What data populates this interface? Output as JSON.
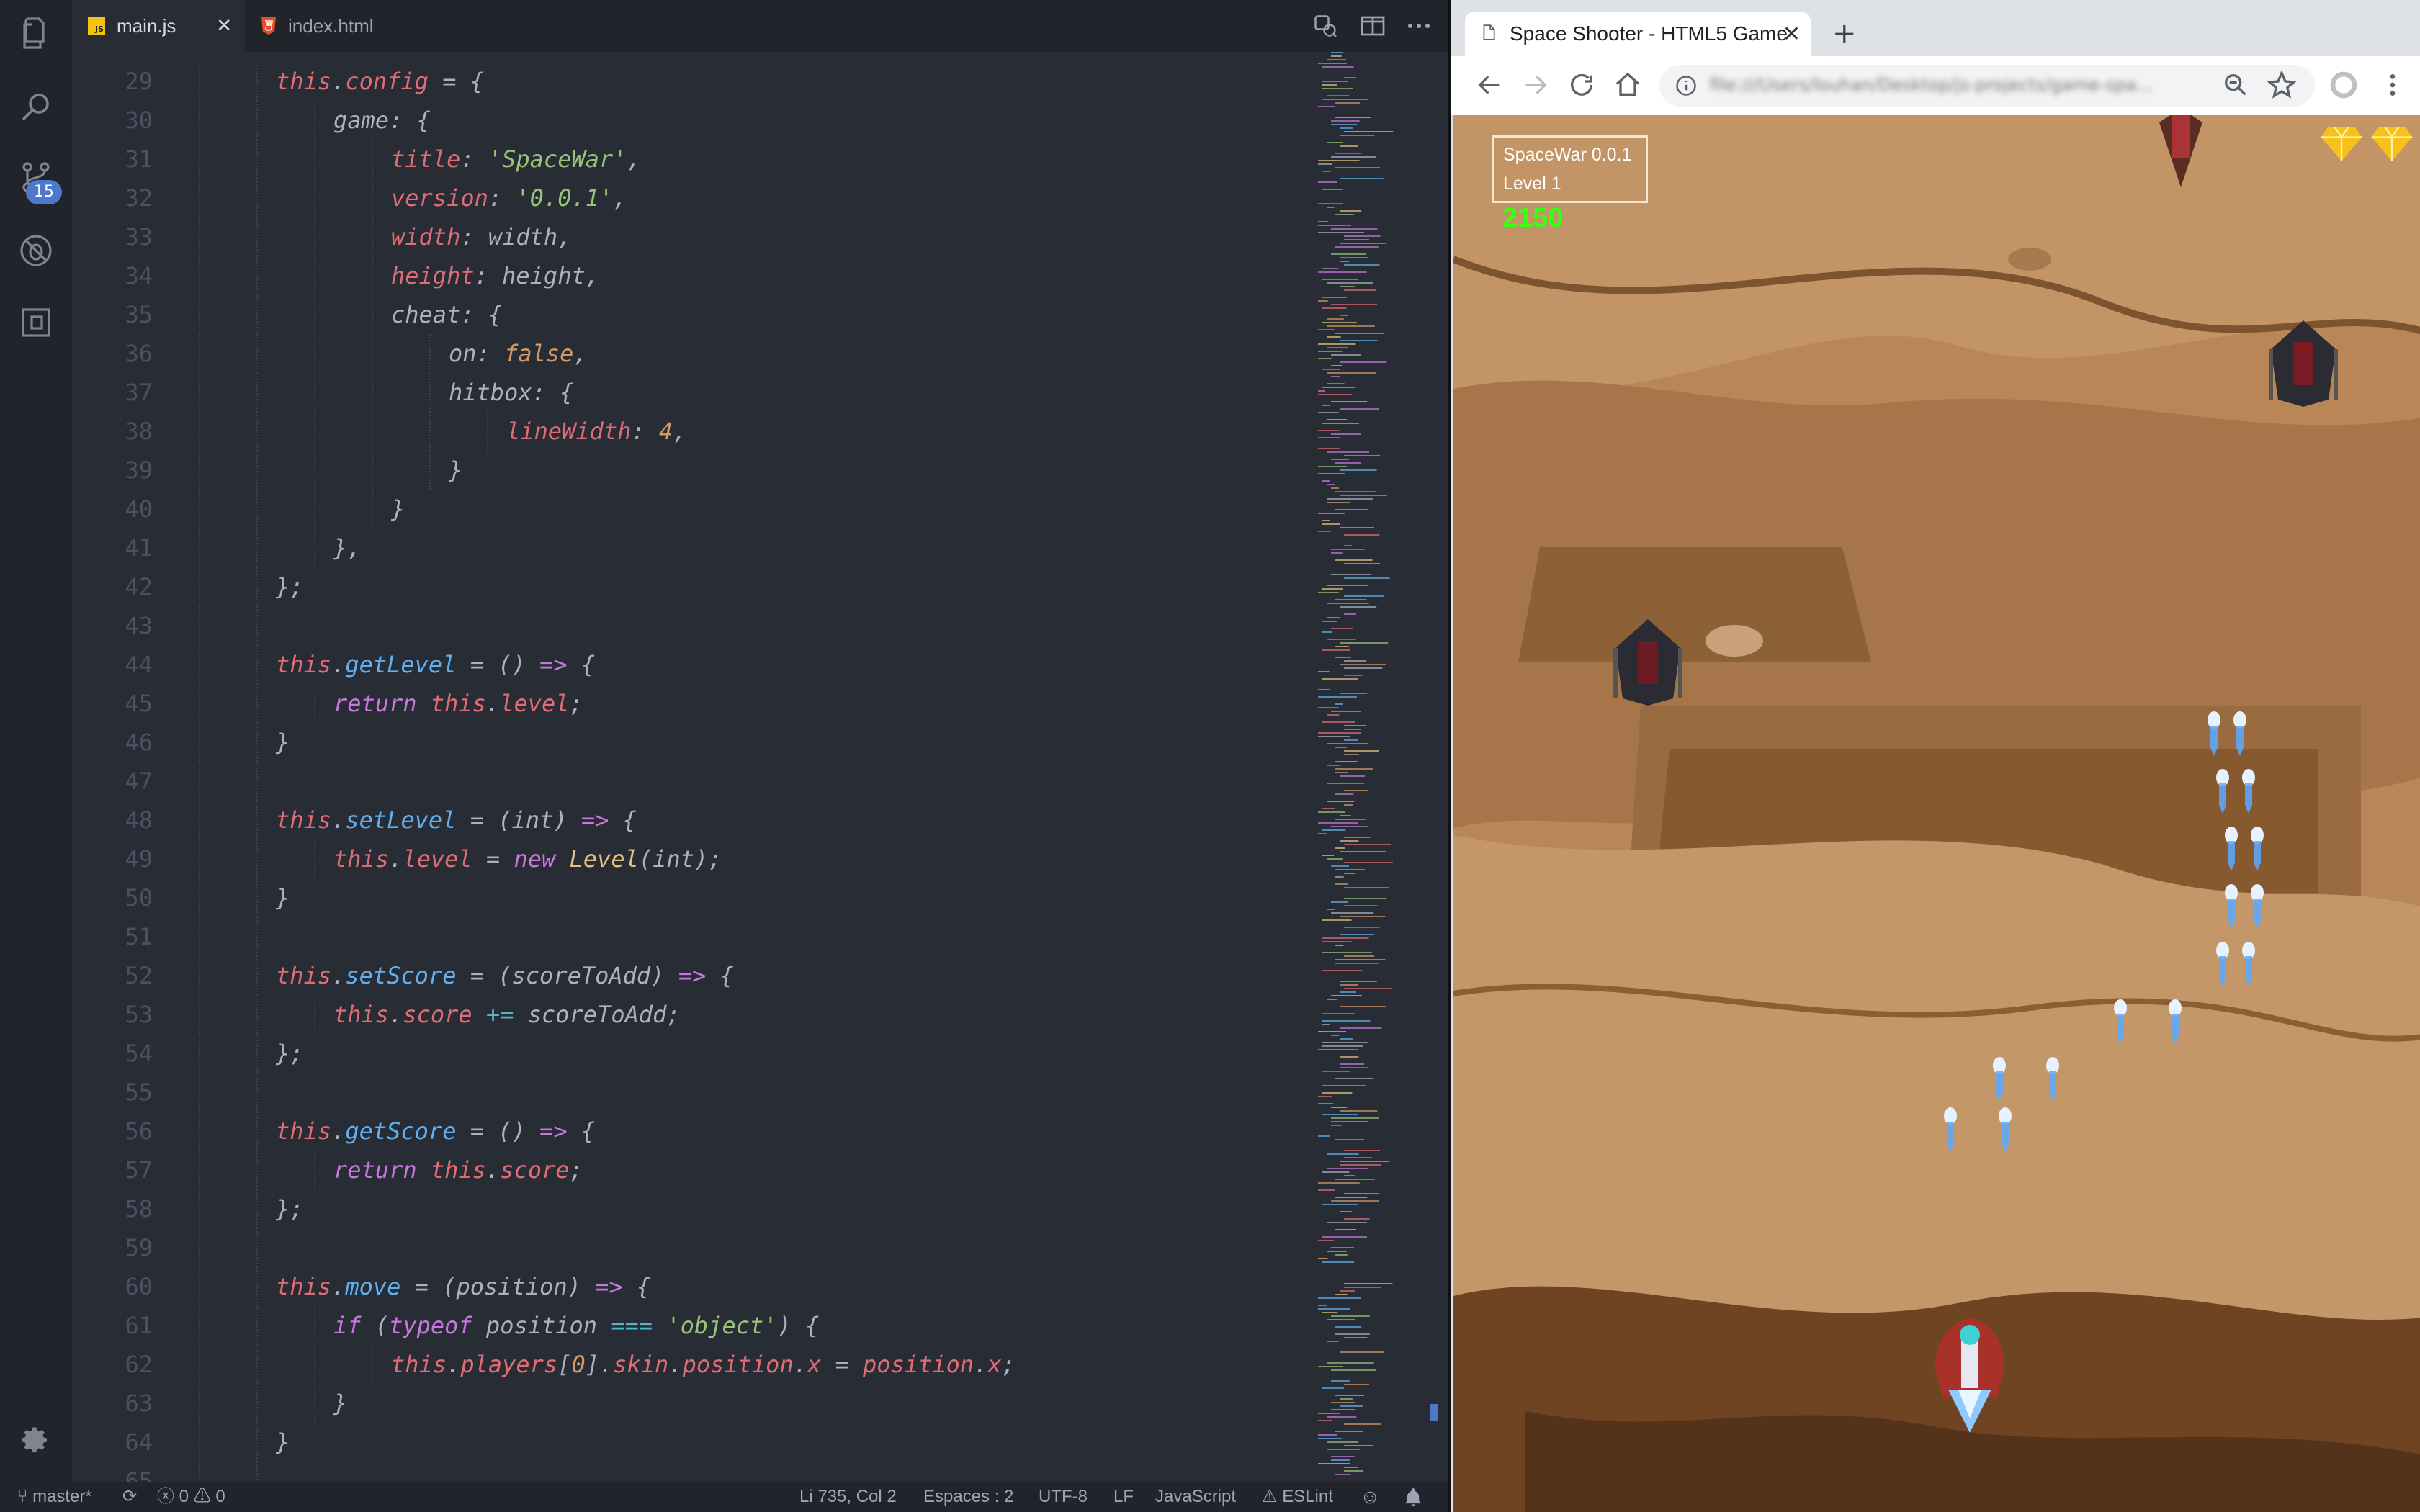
{
  "editor": {
    "tabs": [
      {
        "label": "main.js",
        "icon": "js-file-icon"
      },
      {
        "label": "index.html",
        "icon": "html5-file-icon"
      }
    ],
    "scm_badge": "15",
    "js_badge": "JS",
    "lines": [
      {
        "n": "29",
        "indent": 2,
        "tokens": [
          [
            "this",
            "tok-this"
          ],
          [
            ".",
            ""
          ],
          [
            "config",
            "tok-prop"
          ],
          [
            " = {",
            ""
          ]
        ]
      },
      {
        "n": "30",
        "indent": 3,
        "tokens": [
          [
            "game",
            "tok-key"
          ],
          [
            ": {",
            ""
          ]
        ]
      },
      {
        "n": "31",
        "indent": 4,
        "tokens": [
          [
            "title",
            "tok-prop"
          ],
          [
            ": ",
            ""
          ],
          [
            "'SpaceWar'",
            "tok-str"
          ],
          [
            ",",
            ""
          ]
        ]
      },
      {
        "n": "32",
        "indent": 4,
        "tokens": [
          [
            "version",
            "tok-prop"
          ],
          [
            ": ",
            ""
          ],
          [
            "'0.0.1'",
            "tok-str"
          ],
          [
            ",",
            ""
          ]
        ]
      },
      {
        "n": "33",
        "indent": 4,
        "tokens": [
          [
            "width",
            "tok-prop"
          ],
          [
            ": width,",
            ""
          ]
        ]
      },
      {
        "n": "34",
        "indent": 4,
        "tokens": [
          [
            "height",
            "tok-prop"
          ],
          [
            ": height,",
            ""
          ]
        ]
      },
      {
        "n": "35",
        "indent": 4,
        "tokens": [
          [
            "cheat",
            "tok-key"
          ],
          [
            ": {",
            ""
          ]
        ]
      },
      {
        "n": "36",
        "indent": 5,
        "tokens": [
          [
            "on",
            "tok-key"
          ],
          [
            ": ",
            ""
          ],
          [
            "false",
            "tok-num"
          ],
          [
            ",",
            ""
          ]
        ]
      },
      {
        "n": "37",
        "indent": 5,
        "tokens": [
          [
            "hitbox",
            "tok-key"
          ],
          [
            ": {",
            ""
          ]
        ]
      },
      {
        "n": "38",
        "indent": 6,
        "tokens": [
          [
            "lineWidth",
            "tok-prop"
          ],
          [
            ": ",
            ""
          ],
          [
            "4",
            "tok-num"
          ],
          [
            ",",
            ""
          ]
        ]
      },
      {
        "n": "39",
        "indent": 5,
        "tokens": [
          [
            "}",
            ""
          ]
        ]
      },
      {
        "n": "40",
        "indent": 4,
        "tokens": [
          [
            "}",
            ""
          ]
        ]
      },
      {
        "n": "41",
        "indent": 3,
        "tokens": [
          [
            "},",
            ""
          ]
        ]
      },
      {
        "n": "42",
        "indent": 2,
        "tokens": [
          [
            "};",
            ""
          ]
        ]
      },
      {
        "n": "43",
        "indent": 2,
        "tokens": []
      },
      {
        "n": "44",
        "indent": 2,
        "tokens": [
          [
            "this",
            "tok-this"
          ],
          [
            ".",
            ""
          ],
          [
            "getLevel",
            "tok-fn"
          ],
          [
            " = () ",
            ""
          ],
          [
            "=>",
            "tok-kw"
          ],
          [
            " {",
            ""
          ]
        ]
      },
      {
        "n": "45",
        "indent": 3,
        "tokens": [
          [
            "return",
            "tok-kw"
          ],
          [
            " ",
            ""
          ],
          [
            "this",
            "tok-this"
          ],
          [
            ".",
            ""
          ],
          [
            "level",
            "tok-prop"
          ],
          [
            ";",
            ""
          ]
        ]
      },
      {
        "n": "46",
        "indent": 2,
        "tokens": [
          [
            "}",
            ""
          ]
        ]
      },
      {
        "n": "47",
        "indent": 2,
        "tokens": []
      },
      {
        "n": "48",
        "indent": 2,
        "tokens": [
          [
            "this",
            "tok-this"
          ],
          [
            ".",
            ""
          ],
          [
            "setLevel",
            "tok-fn"
          ],
          [
            " = (int) ",
            ""
          ],
          [
            "=>",
            "tok-kw"
          ],
          [
            " {",
            ""
          ]
        ]
      },
      {
        "n": "49",
        "indent": 3,
        "tokens": [
          [
            "this",
            "tok-this"
          ],
          [
            ".",
            ""
          ],
          [
            "level",
            "tok-prop"
          ],
          [
            " = ",
            ""
          ],
          [
            "new",
            "tok-kw"
          ],
          [
            " ",
            ""
          ],
          [
            "Level",
            "tok-cls"
          ],
          [
            "(int);",
            ""
          ]
        ]
      },
      {
        "n": "50",
        "indent": 2,
        "tokens": [
          [
            "}",
            ""
          ]
        ]
      },
      {
        "n": "51",
        "indent": 2,
        "tokens": []
      },
      {
        "n": "52",
        "indent": 2,
        "tokens": [
          [
            "this",
            "tok-this"
          ],
          [
            ".",
            ""
          ],
          [
            "setScore",
            "tok-fn"
          ],
          [
            " = (scoreToAdd) ",
            ""
          ],
          [
            "=>",
            "tok-kw"
          ],
          [
            " {",
            ""
          ]
        ]
      },
      {
        "n": "53",
        "indent": 3,
        "tokens": [
          [
            "this",
            "tok-this"
          ],
          [
            ".",
            ""
          ],
          [
            "score",
            "tok-prop"
          ],
          [
            " ",
            ""
          ],
          [
            "+=",
            "tok-op"
          ],
          [
            " scoreToAdd;",
            ""
          ]
        ]
      },
      {
        "n": "54",
        "indent": 2,
        "tokens": [
          [
            "};",
            ""
          ]
        ]
      },
      {
        "n": "55",
        "indent": 2,
        "tokens": []
      },
      {
        "n": "56",
        "indent": 2,
        "tokens": [
          [
            "this",
            "tok-this"
          ],
          [
            ".",
            ""
          ],
          [
            "getScore",
            "tok-fn"
          ],
          [
            " = () ",
            ""
          ],
          [
            "=>",
            "tok-kw"
          ],
          [
            " {",
            ""
          ]
        ]
      },
      {
        "n": "57",
        "indent": 3,
        "tokens": [
          [
            "return",
            "tok-kw"
          ],
          [
            " ",
            ""
          ],
          [
            "this",
            "tok-this"
          ],
          [
            ".",
            ""
          ],
          [
            "score",
            "tok-prop"
          ],
          [
            ";",
            ""
          ]
        ]
      },
      {
        "n": "58",
        "indent": 2,
        "tokens": [
          [
            "};",
            ""
          ]
        ]
      },
      {
        "n": "59",
        "indent": 2,
        "tokens": []
      },
      {
        "n": "60",
        "indent": 2,
        "tokens": [
          [
            "this",
            "tok-this"
          ],
          [
            ".",
            ""
          ],
          [
            "move",
            "tok-fn"
          ],
          [
            " = (position) ",
            ""
          ],
          [
            "=>",
            "tok-kw"
          ],
          [
            " {",
            ""
          ]
        ]
      },
      {
        "n": "61",
        "indent": 3,
        "tokens": [
          [
            "if",
            "tok-kw"
          ],
          [
            " (",
            ""
          ],
          [
            "typeof",
            "tok-kw"
          ],
          [
            " position ",
            ""
          ],
          [
            "===",
            "tok-op"
          ],
          [
            " ",
            ""
          ],
          [
            "'object'",
            "tok-str"
          ],
          [
            ") {",
            ""
          ]
        ]
      },
      {
        "n": "62",
        "indent": 4,
        "tokens": [
          [
            "this",
            "tok-this"
          ],
          [
            ".",
            ""
          ],
          [
            "players",
            "tok-prop"
          ],
          [
            "[",
            ""
          ],
          [
            "0",
            "tok-num"
          ],
          [
            "].",
            ""
          ],
          [
            "skin",
            "tok-prop"
          ],
          [
            ".",
            ""
          ],
          [
            "position",
            "tok-prop"
          ],
          [
            ".",
            ""
          ],
          [
            "x",
            "tok-prop"
          ],
          [
            " = ",
            ""
          ],
          [
            "position",
            "tok-var"
          ],
          [
            ".",
            ""
          ],
          [
            "x",
            "tok-prop"
          ],
          [
            ";",
            ""
          ]
        ]
      },
      {
        "n": "63",
        "indent": 3,
        "tokens": [
          [
            "}",
            ""
          ]
        ]
      },
      {
        "n": "64",
        "indent": 2,
        "tokens": [
          [
            "}",
            ""
          ]
        ]
      },
      {
        "n": "65",
        "indent": 2,
        "tokens": []
      }
    ]
  },
  "status_bar": {
    "branch": "master*",
    "errors": "0",
    "warnings": "0",
    "position": "Li 735, Col 2",
    "spaces": "Espaces : 2",
    "encoding": "UTF-8",
    "eol": "LF",
    "language": "JavaScript",
    "linter": "ESLint"
  },
  "browser": {
    "tab_title": "Space Shooter - HTML5 Game",
    "new_tab": "+",
    "url": "file:///Users/louhan/Desktop/js-projects/game-spa..."
  },
  "game": {
    "hud_title": "SpaceWar 0.0.1",
    "hud_level": "Level 1",
    "score": "2150",
    "lives": 2
  },
  "colors": {
    "editor_bg": "#282c34",
    "sidebar_bg": "#21252b",
    "accent": "#4d78cc",
    "score_green": "#39ff14"
  }
}
